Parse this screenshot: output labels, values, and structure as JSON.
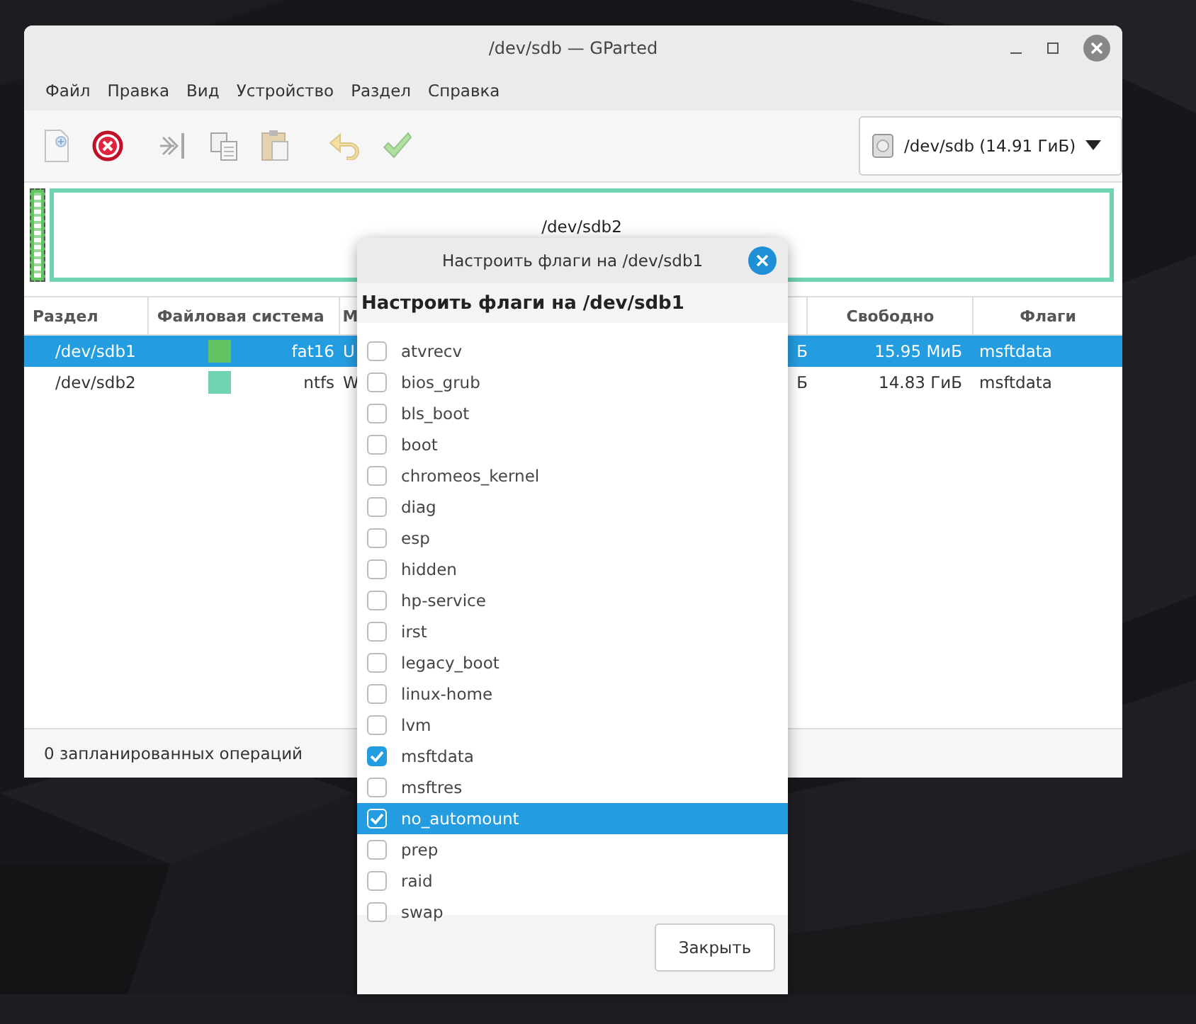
{
  "window": {
    "title": "/dev/sdb — GParted"
  },
  "menu": [
    "Файл",
    "Правка",
    "Вид",
    "Устройство",
    "Раздел",
    "Справка"
  ],
  "toolbar": [
    {
      "kind": "new",
      "disabled": true
    },
    {
      "kind": "delete",
      "disabled": false
    },
    {
      "kind": "resize",
      "disabled": true
    },
    {
      "kind": "copy",
      "disabled": true
    },
    {
      "kind": "paste",
      "disabled": true
    },
    {
      "kind": "undo",
      "disabled": true
    },
    {
      "kind": "apply",
      "disabled": true
    }
  ],
  "device_selector": {
    "value": "/dev/sdb (14.91 ГиБ)"
  },
  "disk_graph": {
    "partitions": [
      {
        "kind": "small",
        "color": "#62c462",
        "selected": true
      },
      {
        "kind": "large",
        "color": "#70d3b0",
        "selected": false,
        "label": "/dev/sdb2"
      }
    ]
  },
  "table": {
    "columns": [
      "Раздел",
      "Файловая система",
      "М",
      "Свободно",
      "Флаги"
    ],
    "rows": [
      {
        "partition": "/dev/sdb1",
        "color": "#62c462",
        "filesystem": "fat16",
        "column_3": "U",
        "column_4": "Б",
        "free": "15.95 МиБ",
        "flags": "msftdata",
        "selected": true
      },
      {
        "partition": "/dev/sdb2",
        "color": "#70d3b0",
        "filesystem": "ntfs",
        "column_3": "W",
        "column_4": "Б",
        "free": "14.83 ГиБ",
        "flags": "msftdata",
        "selected": false
      }
    ]
  },
  "status_bar": "0 запланированных операций",
  "dialog": {
    "title": "Настроить флаги на /dev/sdb1",
    "heading": "Настроить флаги на /dev/sdb1",
    "flags": [
      {
        "label": "atvrecv",
        "checked": false,
        "selected": false
      },
      {
        "label": "bios_grub",
        "checked": false,
        "selected": false
      },
      {
        "label": "bls_boot",
        "checked": false,
        "selected": false
      },
      {
        "label": "boot",
        "checked": false,
        "selected": false
      },
      {
        "label": "chromeos_kernel",
        "checked": false,
        "selected": false
      },
      {
        "label": "diag",
        "checked": false,
        "selected": false
      },
      {
        "label": "esp",
        "checked": false,
        "selected": false
      },
      {
        "label": "hidden",
        "checked": false,
        "selected": false
      },
      {
        "label": "hp-service",
        "checked": false,
        "selected": false
      },
      {
        "label": "irst",
        "checked": false,
        "selected": false
      },
      {
        "label": "legacy_boot",
        "checked": false,
        "selected": false
      },
      {
        "label": "linux-home",
        "checked": false,
        "selected": false
      },
      {
        "label": "lvm",
        "checked": false,
        "selected": false
      },
      {
        "label": "msftdata",
        "checked": true,
        "selected": false
      },
      {
        "label": "msftres",
        "checked": false,
        "selected": false
      },
      {
        "label": "no_automount",
        "checked": true,
        "selected": true
      },
      {
        "label": "prep",
        "checked": false,
        "selected": false
      },
      {
        "label": "raid",
        "checked": false,
        "selected": false
      },
      {
        "label": "swap",
        "checked": false,
        "selected": false
      }
    ],
    "close_button": "Закрыть"
  }
}
